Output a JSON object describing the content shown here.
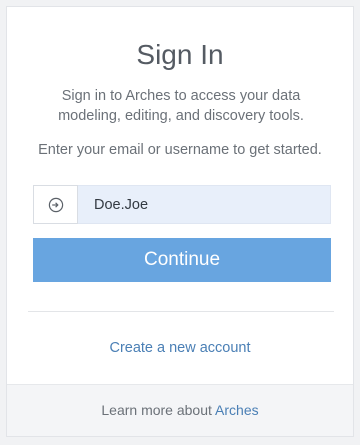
{
  "signin": {
    "title": "Sign In",
    "subtitle": "Sign in to Arches to access your data modeling, editing, and discovery tools.",
    "prompt": "Enter your email or username to get started.",
    "username_value": "Doe.Joe",
    "login_icon": "sign-in-icon",
    "continue_label": "Continue",
    "create_account_label": "Create a new account"
  },
  "footer": {
    "text": "Learn more about",
    "link_label": "Arches"
  },
  "colors": {
    "primary_button": "#68a5e0",
    "link": "#4a7fb5",
    "input_background": "#e8effa"
  }
}
